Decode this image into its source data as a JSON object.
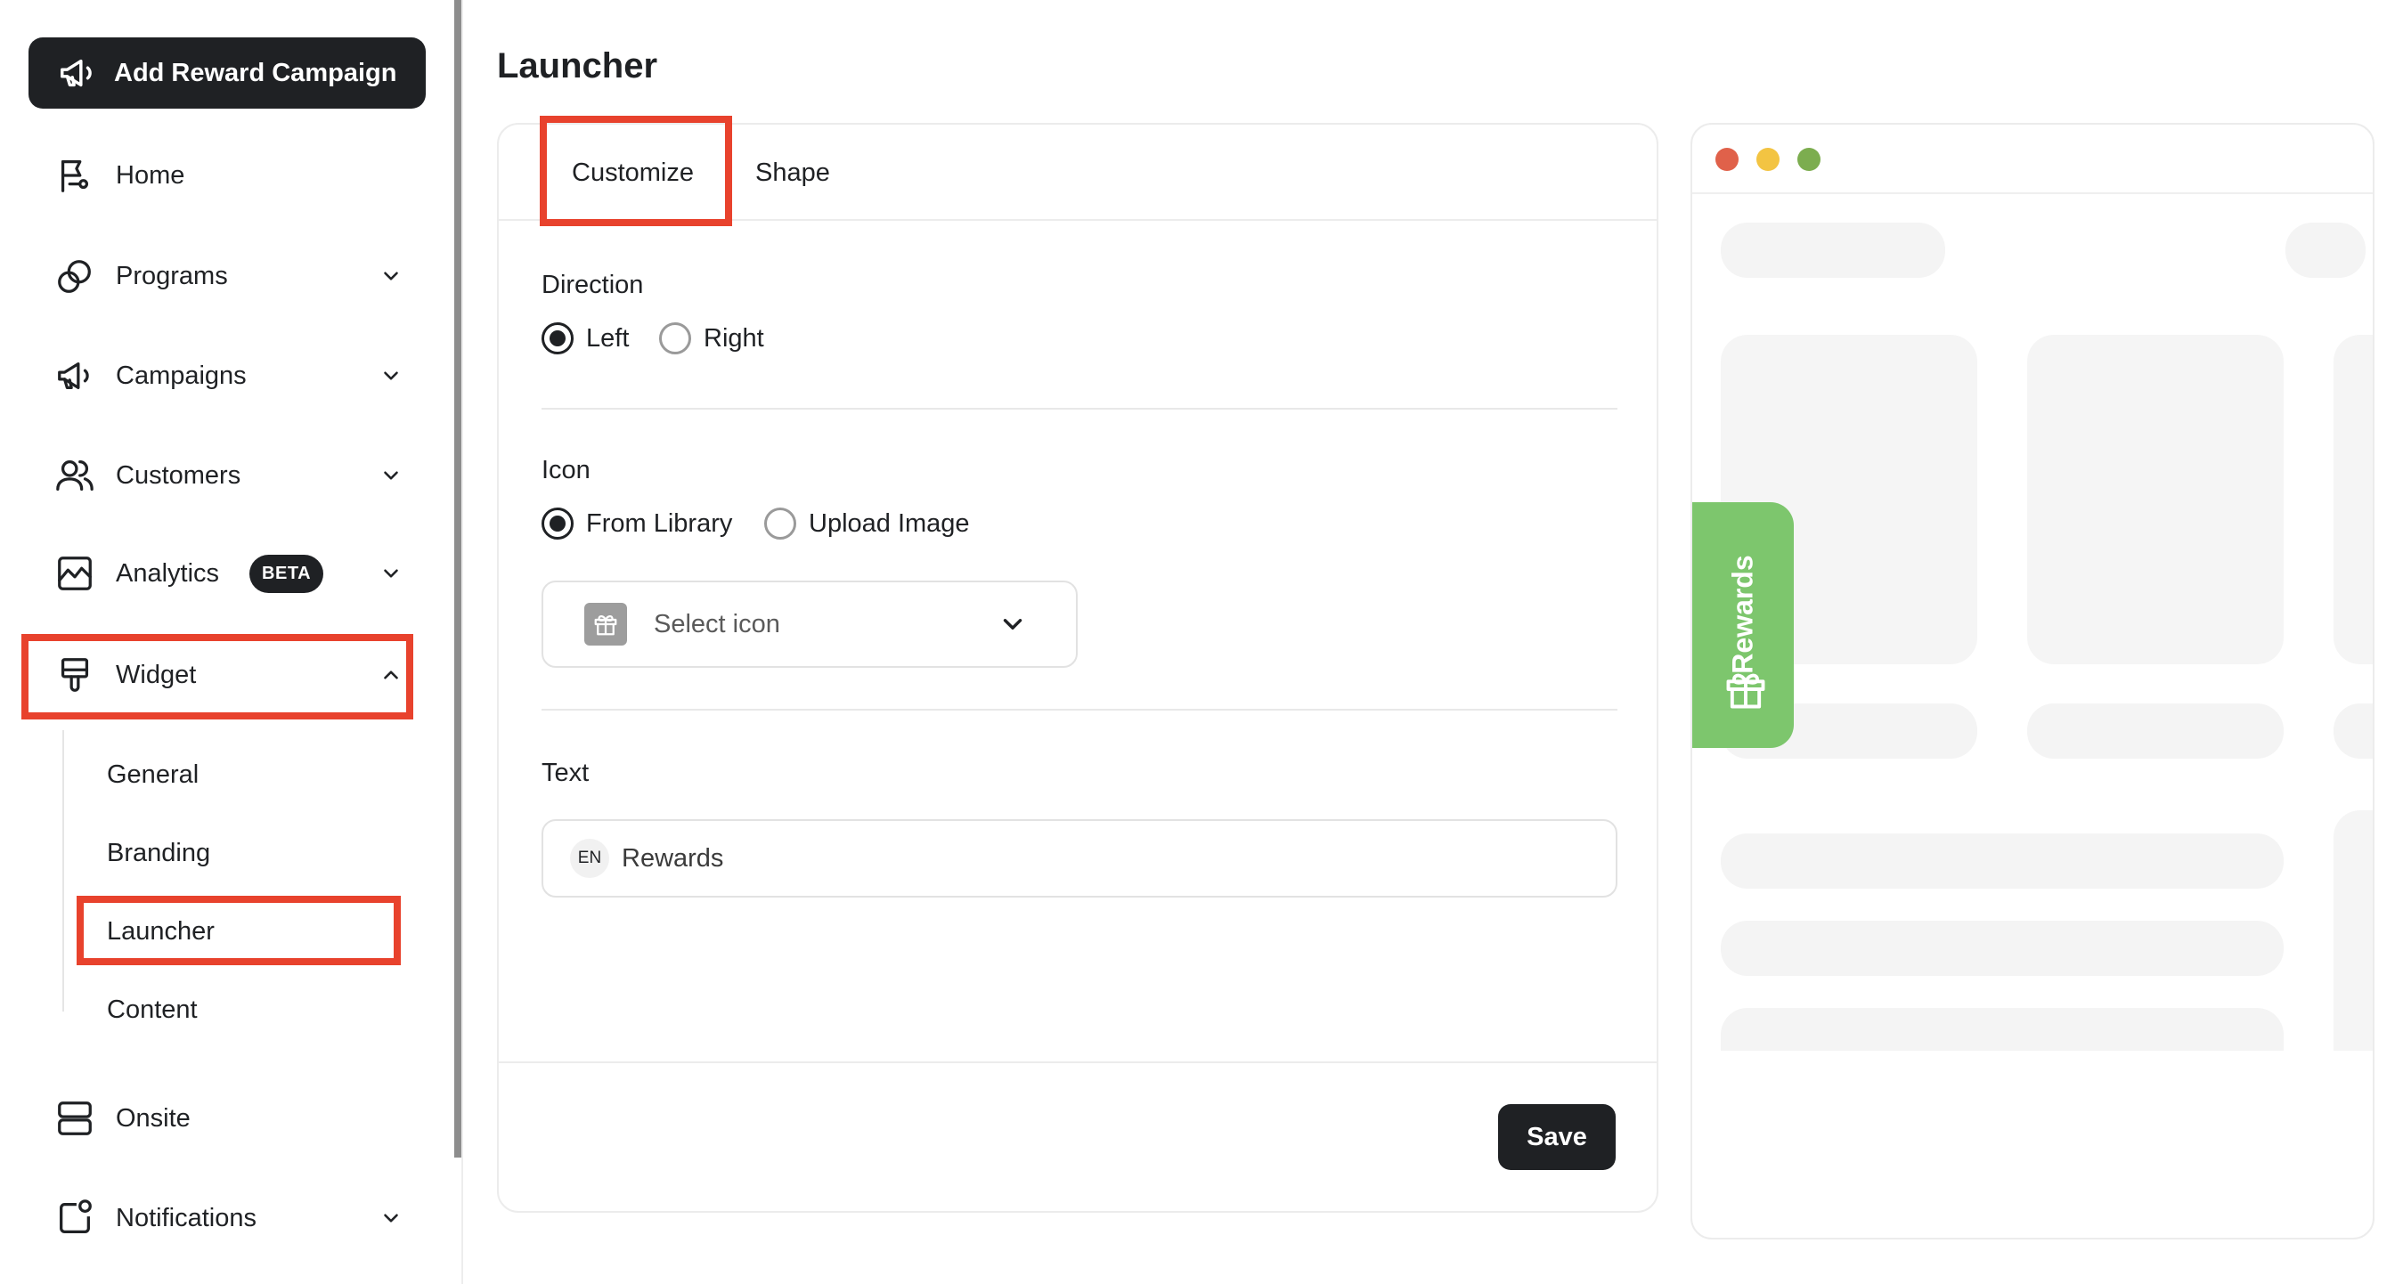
{
  "sidebar": {
    "add_campaign_label": "Add Reward Campaign",
    "items": {
      "home": "Home",
      "programs": "Programs",
      "campaigns": "Campaigns",
      "customers": "Customers",
      "analytics": "Analytics",
      "analytics_badge": "BETA",
      "widget": "Widget",
      "onsite": "Onsite",
      "notifications": "Notifications"
    },
    "widget_subitems": {
      "general": "General",
      "branding": "Branding",
      "launcher": "Launcher",
      "content": "Content"
    }
  },
  "main": {
    "page_title": "Launcher",
    "tabs": {
      "customize": "Customize",
      "shape": "Shape"
    },
    "direction": {
      "label": "Direction",
      "options": {
        "left": "Left",
        "right": "Right"
      },
      "selected": "Left"
    },
    "icon": {
      "label": "Icon",
      "options": {
        "from_library": "From Library",
        "upload_image": "Upload Image"
      },
      "selected": "From Library",
      "select_placeholder": "Select icon"
    },
    "text": {
      "label": "Text",
      "language": "EN",
      "value": "Rewards"
    },
    "save_label": "Save"
  },
  "preview": {
    "launcher_text": "Rewards",
    "launcher_color": "#7dc66d",
    "dots": [
      "#e0614a",
      "#f3c442",
      "#7cad4f"
    ]
  },
  "colors": {
    "highlight": "#e8422d",
    "dark": "#1f2124"
  }
}
